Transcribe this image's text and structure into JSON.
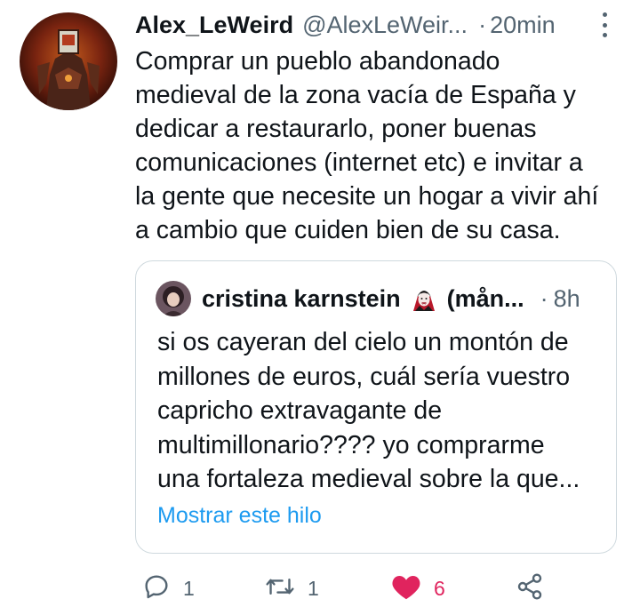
{
  "tweet": {
    "display_name": "Alex_LeWeird",
    "handle": "@AlexLeWeir...",
    "separator": "·",
    "time": "20min",
    "text": "Comprar un pueblo abandonado\nmedieval de la zona vacía de España y\ndedicar a restaurarlo, poner buenas\ncomunicaciones (internet etc) e invitar a\nla gente que necesite un hogar a vivir ahí\na cambio que cuiden bien de su casa."
  },
  "quote": {
    "display_name": "cristina karnstein",
    "name_suffix": "(mån...",
    "separator": "·",
    "time": "8h",
    "text": "si os cayeran del cielo un montón de\nmillones de euros, cuál sería vuestro\ncapricho extravagante de\nmultimillonario???? yo comprarme\nuna fortaleza medieval sobre la que...",
    "show_thread": "Mostrar este hilo"
  },
  "actions": {
    "reply_count": "1",
    "retweet_count": "1",
    "like_count": "6"
  },
  "colors": {
    "text_primary": "#0f1419",
    "text_secondary": "#536471",
    "link": "#1d9bf0",
    "like": "#e0245e",
    "border": "#cfd9de"
  },
  "icons": [
    "more-icon",
    "reply-icon",
    "retweet-icon",
    "like-icon",
    "share-icon",
    "vampire-emoji-icon"
  ]
}
